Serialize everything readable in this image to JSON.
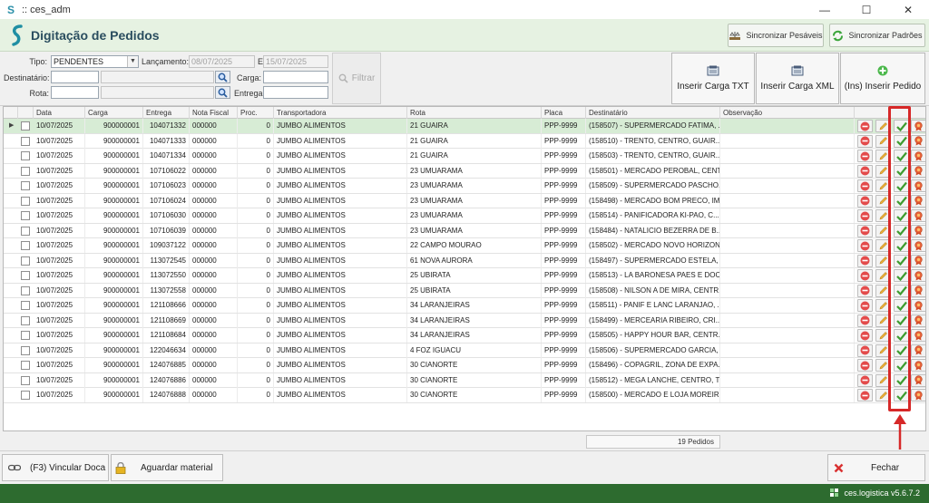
{
  "window": {
    "title": ":: ces_adm",
    "minimize": "—",
    "maximize": "☐",
    "close": "✕"
  },
  "header": {
    "title": "Digitação de Pedidos",
    "sync_pesaveis": "Sincronizar Pesáveis",
    "sync_padroes": "Sincronizar Padrões"
  },
  "filters": {
    "tipo_label": "Tipo:",
    "tipo_value": "PENDENTES",
    "lancamento_label": "Lançamento:",
    "date_from": "08/07/2025",
    "e_label": "E",
    "date_to": "15/07/2025",
    "destinatario_label": "Destinatário:",
    "carga_label": "Carga:",
    "rota_label": "Rota:",
    "entrega_label": "Entrega:",
    "filtrar": "Filtrar"
  },
  "actions": {
    "inserir_txt": "Inserir Carga TXT",
    "inserir_xml": "Inserir Carga XML",
    "inserir_pedido": "(Ins) Inserir Pedido"
  },
  "columns": [
    "Data",
    "Carga",
    "Entrega",
    "Nota Fiscal",
    "Proc.",
    "Transportadora",
    "Rota",
    "Placa",
    "Destinatário",
    "Observação"
  ],
  "rows": [
    {
      "data": "10/07/2025",
      "carga": "900000001",
      "entrega": "104071332",
      "nf": "000000",
      "proc": "0",
      "transp": "JUMBO ALIMENTOS",
      "rota": "21 GUAIRA",
      "placa": "PPP-9999",
      "dest": "(158507) - SUPERMERCADO FATIMA, ..."
    },
    {
      "data": "10/07/2025",
      "carga": "900000001",
      "entrega": "104071333",
      "nf": "000000",
      "proc": "0",
      "transp": "JUMBO ALIMENTOS",
      "rota": "21 GUAIRA",
      "placa": "PPP-9999",
      "dest": "(158510) - TRENTO, CENTRO, GUAIR..."
    },
    {
      "data": "10/07/2025",
      "carga": "900000001",
      "entrega": "104071334",
      "nf": "000000",
      "proc": "0",
      "transp": "JUMBO ALIMENTOS",
      "rota": "21 GUAIRA",
      "placa": "PPP-9999",
      "dest": "(158503) - TRENTO, CENTRO, GUAIR..."
    },
    {
      "data": "10/07/2025",
      "carga": "900000001",
      "entrega": "107106022",
      "nf": "000000",
      "proc": "0",
      "transp": "JUMBO ALIMENTOS",
      "rota": "23 UMUARAMA",
      "placa": "PPP-9999",
      "dest": "(158501) - MERCADO PEROBAL, CENT..."
    },
    {
      "data": "10/07/2025",
      "carga": "900000001",
      "entrega": "107106023",
      "nf": "000000",
      "proc": "0",
      "transp": "JUMBO ALIMENTOS",
      "rota": "23 UMUARAMA",
      "placa": "PPP-9999",
      "dest": "(158509) - SUPERMERCADO PASCHO..."
    },
    {
      "data": "10/07/2025",
      "carga": "900000001",
      "entrega": "107106024",
      "nf": "000000",
      "proc": "0",
      "transp": "JUMBO ALIMENTOS",
      "rota": "23 UMUARAMA",
      "placa": "PPP-9999",
      "dest": "(158498) - MERCADO BOM PRECO, IM..."
    },
    {
      "data": "10/07/2025",
      "carga": "900000001",
      "entrega": "107106030",
      "nf": "000000",
      "proc": "0",
      "transp": "JUMBO ALIMENTOS",
      "rota": "23 UMUARAMA",
      "placa": "PPP-9999",
      "dest": "(158514) - PANIFICADORA KI-PAO, C..."
    },
    {
      "data": "10/07/2025",
      "carga": "900000001",
      "entrega": "107106039",
      "nf": "000000",
      "proc": "0",
      "transp": "JUMBO ALIMENTOS",
      "rota": "23 UMUARAMA",
      "placa": "PPP-9999",
      "dest": "(158484) - NATALICIO BEZERRA DE B..."
    },
    {
      "data": "10/07/2025",
      "carga": "900000001",
      "entrega": "109037122",
      "nf": "000000",
      "proc": "0",
      "transp": "JUMBO ALIMENTOS",
      "rota": "22 CAMPO MOURAO",
      "placa": "PPP-9999",
      "dest": "(158502) - MERCADO NOVO HORIZON..."
    },
    {
      "data": "10/07/2025",
      "carga": "900000001",
      "entrega": "113072545",
      "nf": "000000",
      "proc": "0",
      "transp": "JUMBO ALIMENTOS",
      "rota": "61 NOVA AURORA",
      "placa": "PPP-9999",
      "dest": "(158497) - SUPERMERCADO ESTELA, ..."
    },
    {
      "data": "10/07/2025",
      "carga": "900000001",
      "entrega": "113072550",
      "nf": "000000",
      "proc": "0",
      "transp": "JUMBO ALIMENTOS",
      "rota": "25 UBIRATA",
      "placa": "PPP-9999",
      "dest": "(158513) - LA BARONESA PAES E DOC..."
    },
    {
      "data": "10/07/2025",
      "carga": "900000001",
      "entrega": "113072558",
      "nf": "000000",
      "proc": "0",
      "transp": "JUMBO ALIMENTOS",
      "rota": "25 UBIRATA",
      "placa": "PPP-9999",
      "dest": "(158508) - NILSON A DE MIRA, CENTR..."
    },
    {
      "data": "10/07/2025",
      "carga": "900000001",
      "entrega": "121108666",
      "nf": "000000",
      "proc": "0",
      "transp": "JUMBO ALIMENTOS",
      "rota": "34 LARANJEIRAS",
      "placa": "PPP-9999",
      "dest": "(158511) - PANIF E LANC LARANJAO, ..."
    },
    {
      "data": "10/07/2025",
      "carga": "900000001",
      "entrega": "121108669",
      "nf": "000000",
      "proc": "0",
      "transp": "JUMBO ALIMENTOS",
      "rota": "34 LARANJEIRAS",
      "placa": "PPP-9999",
      "dest": "(158499) - MERCEARIA RIBEIRO, CRI..."
    },
    {
      "data": "10/07/2025",
      "carga": "900000001",
      "entrega": "121108684",
      "nf": "000000",
      "proc": "0",
      "transp": "JUMBO ALIMENTOS",
      "rota": "34 LARANJEIRAS",
      "placa": "PPP-9999",
      "dest": "(158505) - HAPPY HOUR BAR, CENTR..."
    },
    {
      "data": "10/07/2025",
      "carga": "900000001",
      "entrega": "122046634",
      "nf": "000000",
      "proc": "0",
      "transp": "JUMBO ALIMENTOS",
      "rota": "4 FOZ IGUACU",
      "placa": "PPP-9999",
      "dest": "(158506) - SUPERMERCADO GARCIA, ..."
    },
    {
      "data": "10/07/2025",
      "carga": "900000001",
      "entrega": "124076885",
      "nf": "000000",
      "proc": "0",
      "transp": "JUMBO ALIMENTOS",
      "rota": "30 CIANORTE",
      "placa": "PPP-9999",
      "dest": "(158496) - COPAGRIL, ZONA DE EXPA..."
    },
    {
      "data": "10/07/2025",
      "carga": "900000001",
      "entrega": "124076886",
      "nf": "000000",
      "proc": "0",
      "transp": "JUMBO ALIMENTOS",
      "rota": "30 CIANORTE",
      "placa": "PPP-9999",
      "dest": "(158512) - MEGA LANCHE, CENTRO, T..."
    },
    {
      "data": "10/07/2025",
      "carga": "900000001",
      "entrega": "124076888",
      "nf": "000000",
      "proc": "0",
      "transp": "JUMBO ALIMENTOS",
      "rota": "30 CIANORTE",
      "placa": "PPP-9999",
      "dest": "(158500) - MERCADO E LOJA MOREIR..."
    }
  ],
  "count_label": "19 Pedidos",
  "bottom": {
    "vincular_doca": "(F3) Vincular Doca",
    "aguardar_material": "Aguardar material",
    "fechar": "Fechar"
  },
  "status": {
    "brand": "ces.logistica v5.6.7.2"
  },
  "colors": {
    "header_bg": "#e6f2e2",
    "selected_row": "#d7ecd5",
    "status_bar": "#2d6b2f",
    "annotation": "#d62828"
  },
  "icons": [
    "search-icon",
    "delete-icon",
    "edit-icon",
    "check-icon",
    "badge-icon",
    "sync-icon",
    "scale-icon",
    "link-icon",
    "lock-icon",
    "close-icon",
    "plus-icon",
    "document-icon"
  ]
}
